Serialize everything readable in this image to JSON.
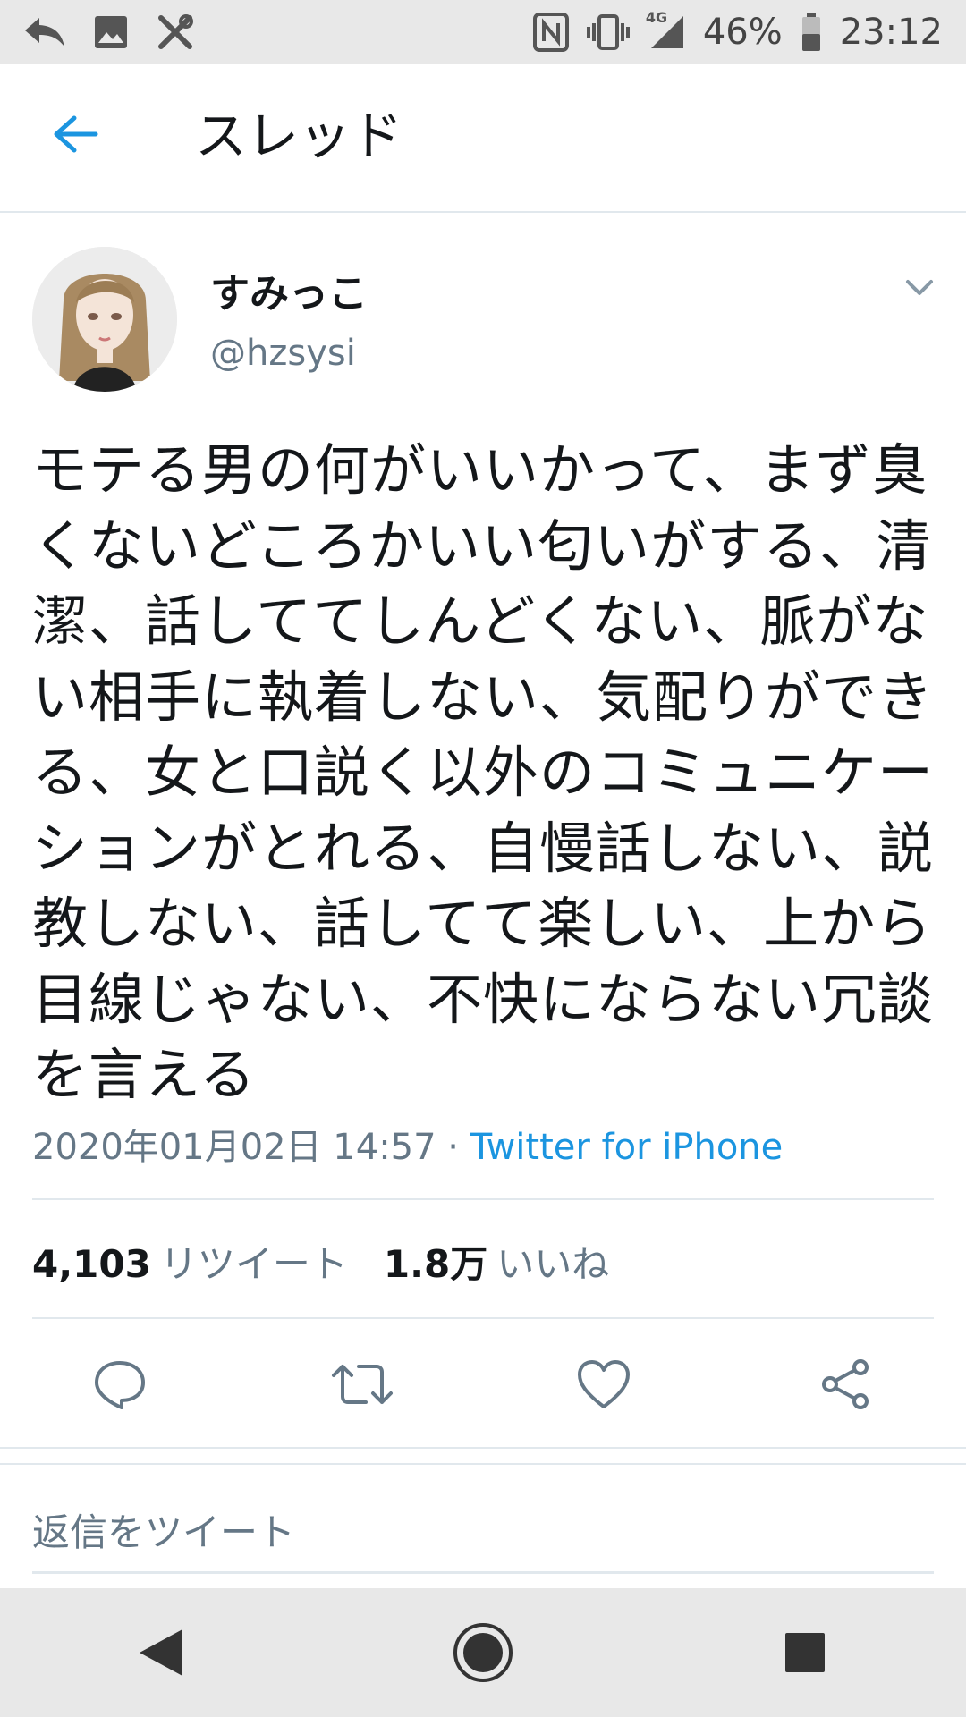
{
  "status_bar": {
    "network": "4G",
    "battery": "46%",
    "time": "23:12",
    "icons": [
      "reply-icon",
      "image-icon",
      "tools-icon",
      "nfc-icon",
      "vibrate-icon",
      "signal-icon",
      "battery-icon"
    ]
  },
  "header": {
    "title": "スレッド"
  },
  "tweet": {
    "display_name": "すみっこ",
    "handle": "@hzsysi",
    "text": "モテる男の何がいいかって、まず臭くないどころかいい匂いがする、清潔、話しててしんどくない、脈がない相手に執着しない、気配りができる、女と口説く以外のコミュニケーションがとれる、自慢話しない、説教しない、話してて楽しい、上から目線じゃない、不快にならない冗談を言える",
    "timestamp": "2020年01月02日 14:57",
    "separator": " · ",
    "source": "Twitter for iPhone",
    "retweet_count": "4,103",
    "retweet_label": "リツイート",
    "like_count": "1.8万",
    "like_label": "いいね"
  },
  "reply": {
    "placeholder": "返信をツイート"
  },
  "colors": {
    "accent": "#1b95e0",
    "secondary_text": "#657786",
    "divider": "#e1e8ed",
    "system_bar": "#e8e8e8"
  }
}
